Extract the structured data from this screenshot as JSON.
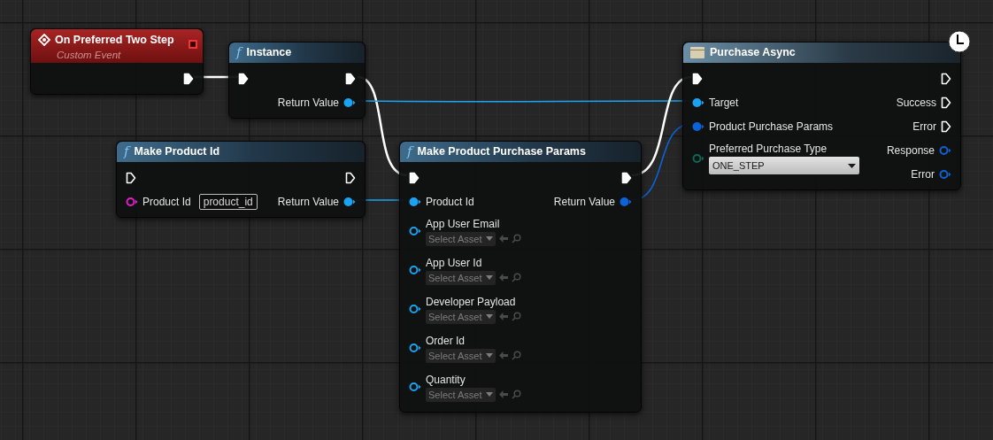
{
  "nodes": [
    {
      "kind": "event",
      "title": "On Preferred Two Step",
      "subtitle": "Custom Event",
      "outputs": [
        {
          "kind": "exec",
          "connected": true
        }
      ]
    },
    {
      "kind": "function",
      "glyph": "f",
      "title": "Instance",
      "inputs": [
        {
          "kind": "exec",
          "connected": true
        }
      ],
      "outputs": [
        {
          "kind": "exec",
          "connected": true
        },
        {
          "kind": "data",
          "label": "Return Value",
          "connected": true,
          "color": "#1aa3f0"
        }
      ]
    },
    {
      "kind": "function",
      "glyph": "f",
      "title": "Make Product Id",
      "inputs": [
        {
          "kind": "exec",
          "connected": false
        },
        {
          "kind": "data",
          "label": "Product Id",
          "connected": false,
          "color": "#e020c8",
          "widget": {
            "kind": "text",
            "value": "product_id"
          }
        }
      ],
      "outputs": [
        {
          "kind": "exec",
          "connected": false
        },
        {
          "kind": "data",
          "label": "Return Value",
          "connected": true,
          "color": "#1aa3f0"
        }
      ]
    },
    {
      "kind": "function",
      "glyph": "f",
      "title": "Make Product Purchase Params",
      "inputs": [
        {
          "kind": "exec",
          "connected": true
        },
        {
          "kind": "data",
          "label": "Product Id",
          "connected": true,
          "color": "#1aa3f0"
        },
        {
          "kind": "data",
          "label": "App User Email",
          "connected": false,
          "color": "#1aa3f0",
          "widget": {
            "kind": "asset",
            "value": "Select Asset"
          }
        },
        {
          "kind": "data",
          "label": "App User Id",
          "connected": false,
          "color": "#1aa3f0",
          "widget": {
            "kind": "asset",
            "value": "Select Asset"
          }
        },
        {
          "kind": "data",
          "label": "Developer Payload",
          "connected": false,
          "color": "#1aa3f0",
          "widget": {
            "kind": "asset",
            "value": "Select Asset"
          }
        },
        {
          "kind": "data",
          "label": "Order Id",
          "connected": false,
          "color": "#1aa3f0",
          "widget": {
            "kind": "asset",
            "value": "Select Asset"
          }
        },
        {
          "kind": "data",
          "label": "Quantity",
          "connected": false,
          "color": "#1aa3f0",
          "widget": {
            "kind": "asset",
            "value": "Select Asset"
          }
        }
      ],
      "outputs": [
        {
          "kind": "exec",
          "connected": true
        },
        {
          "kind": "data",
          "label": "Return Value",
          "connected": true,
          "color": "#0b63d8"
        }
      ]
    },
    {
      "kind": "async",
      "title": "Purchase Async",
      "inputs": [
        {
          "kind": "exec",
          "connected": true
        },
        {
          "kind": "data",
          "label": "Target",
          "connected": true,
          "color": "#1aa3f0"
        },
        {
          "kind": "data",
          "label": "Product Purchase Params",
          "connected": true,
          "color": "#0b63d8"
        },
        {
          "kind": "data",
          "label": "Preferred Purchase Type",
          "connected": false,
          "color": "#0a6a58",
          "widget": {
            "kind": "enum",
            "value": "ONE_STEP"
          }
        }
      ],
      "outputs": [
        {
          "kind": "exec",
          "connected": false
        },
        {
          "kind": "exec",
          "label": "Success",
          "connected": false
        },
        {
          "kind": "exec",
          "label": "Error",
          "connected": false
        },
        {
          "kind": "data",
          "label": "Response",
          "connected": false,
          "color": "#0b63d8"
        },
        {
          "kind": "data",
          "label": "Error",
          "connected": false,
          "color": "#0b63d8"
        }
      ]
    }
  ]
}
